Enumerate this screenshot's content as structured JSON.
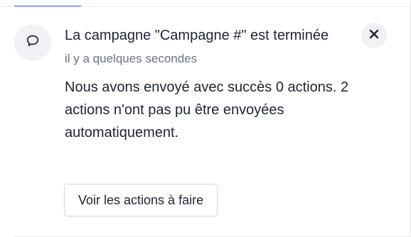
{
  "notification": {
    "icon": "comment-icon",
    "title": "La campagne \"Campagne #\" est terminée",
    "timestamp": "il y a quelques secondes",
    "message": "Nous avons envoyé avec succès 0 actions. 2 actions n'ont pas pu être envoyées automatiquement.",
    "action_label": "Voir les actions à faire",
    "close_icon": "close-icon"
  },
  "colors": {
    "text_primary": "#1f2433",
    "text_secondary": "#6b7280",
    "icon_bg": "#f1f2f5",
    "accent": "#3b5bdb",
    "border": "#d5d8de"
  }
}
